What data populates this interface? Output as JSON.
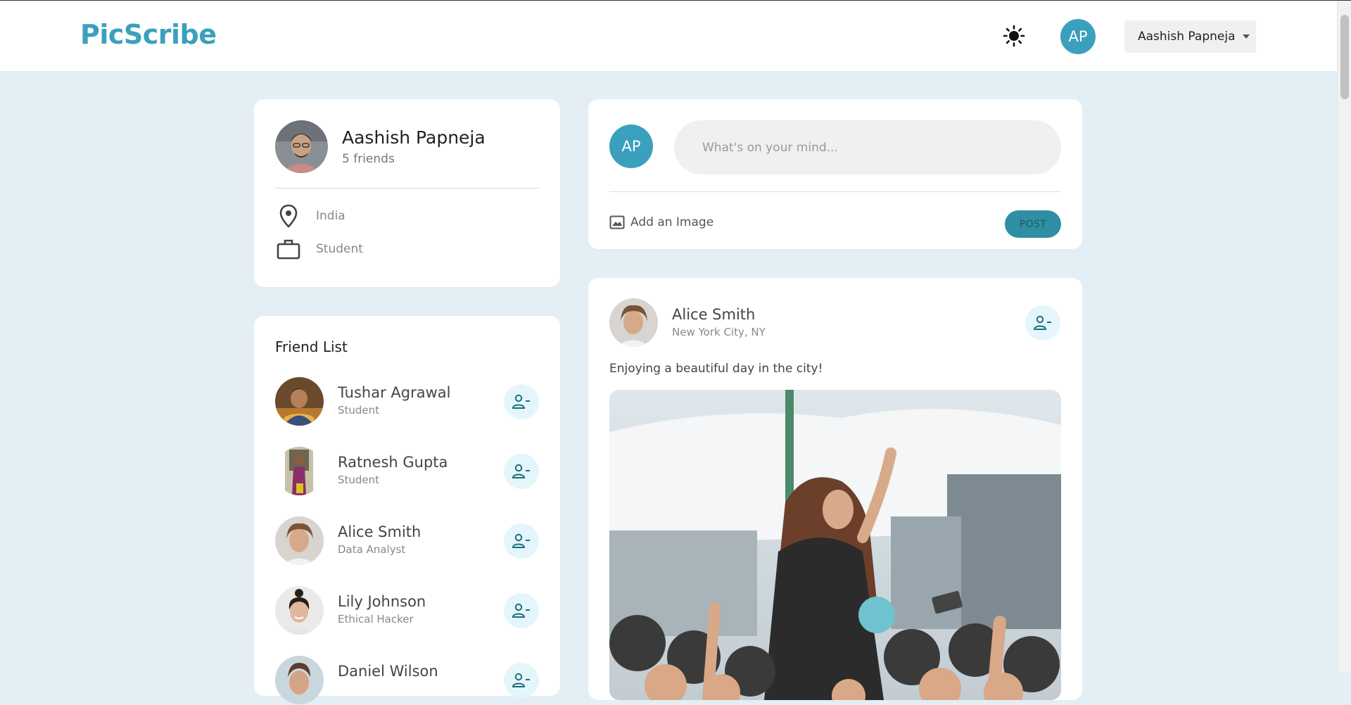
{
  "header": {
    "brand": "PicScribe",
    "avatar_initials": "AP",
    "user_menu_label": "Aashish Papneja",
    "theme_icon": "sun-icon"
  },
  "profile": {
    "name": "Aashish Papneja",
    "friends_count": "5 friends",
    "location": "India",
    "occupation": "Student",
    "location_icon": "location-pin-icon",
    "occupation_icon": "briefcase-icon"
  },
  "friend_list": {
    "title": "Friend List",
    "friends": [
      {
        "name": "Tushar Agrawal",
        "occupation": "Student"
      },
      {
        "name": "Ratnesh Gupta",
        "occupation": "Student"
      },
      {
        "name": "Alice Smith",
        "occupation": "Data Analyst"
      },
      {
        "name": "Lily Johnson",
        "occupation": "Ethical Hacker"
      },
      {
        "name": "Daniel Wilson",
        "occupation": ""
      }
    ]
  },
  "composer": {
    "avatar_initials": "AP",
    "placeholder": "What's on your mind...",
    "value": "",
    "add_image_label": "Add an Image",
    "post_label": "POST"
  },
  "post": {
    "author": "Alice Smith",
    "location": "New York City, NY",
    "text": "Enjoying a beautiful day in the city!"
  },
  "colors": {
    "brand": "#3aa0bd",
    "page_background": "#e3eef5",
    "accent_light": "#e4f6fb",
    "post_button": "#2e8fa3"
  }
}
